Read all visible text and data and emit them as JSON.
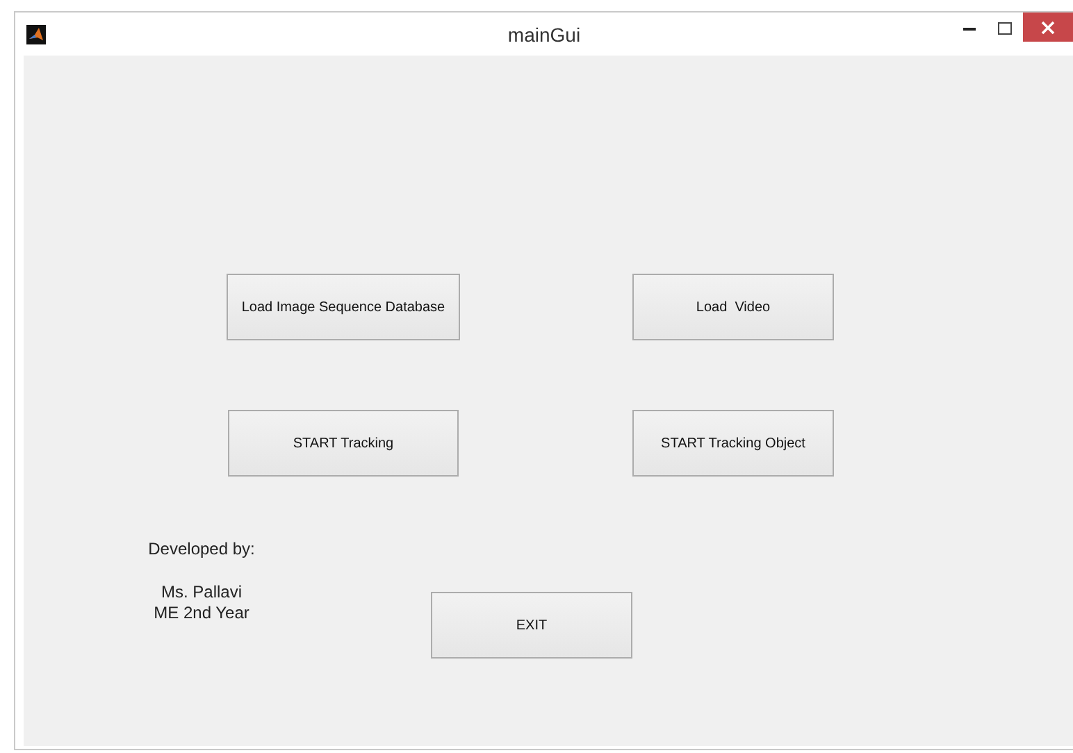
{
  "window": {
    "title": "mainGui"
  },
  "buttons": [
    {
      "label": "Load Image Sequence Database"
    },
    {
      "label": "Load  Video"
    },
    {
      "label": "START Tracking"
    },
    {
      "label": "START Tracking Object"
    }
  ],
  "credits": {
    "heading": "Developed by:",
    "name": "Ms. Pallavi",
    "detail": "ME 2nd Year"
  },
  "exit_button": {
    "label": "EXIT"
  }
}
